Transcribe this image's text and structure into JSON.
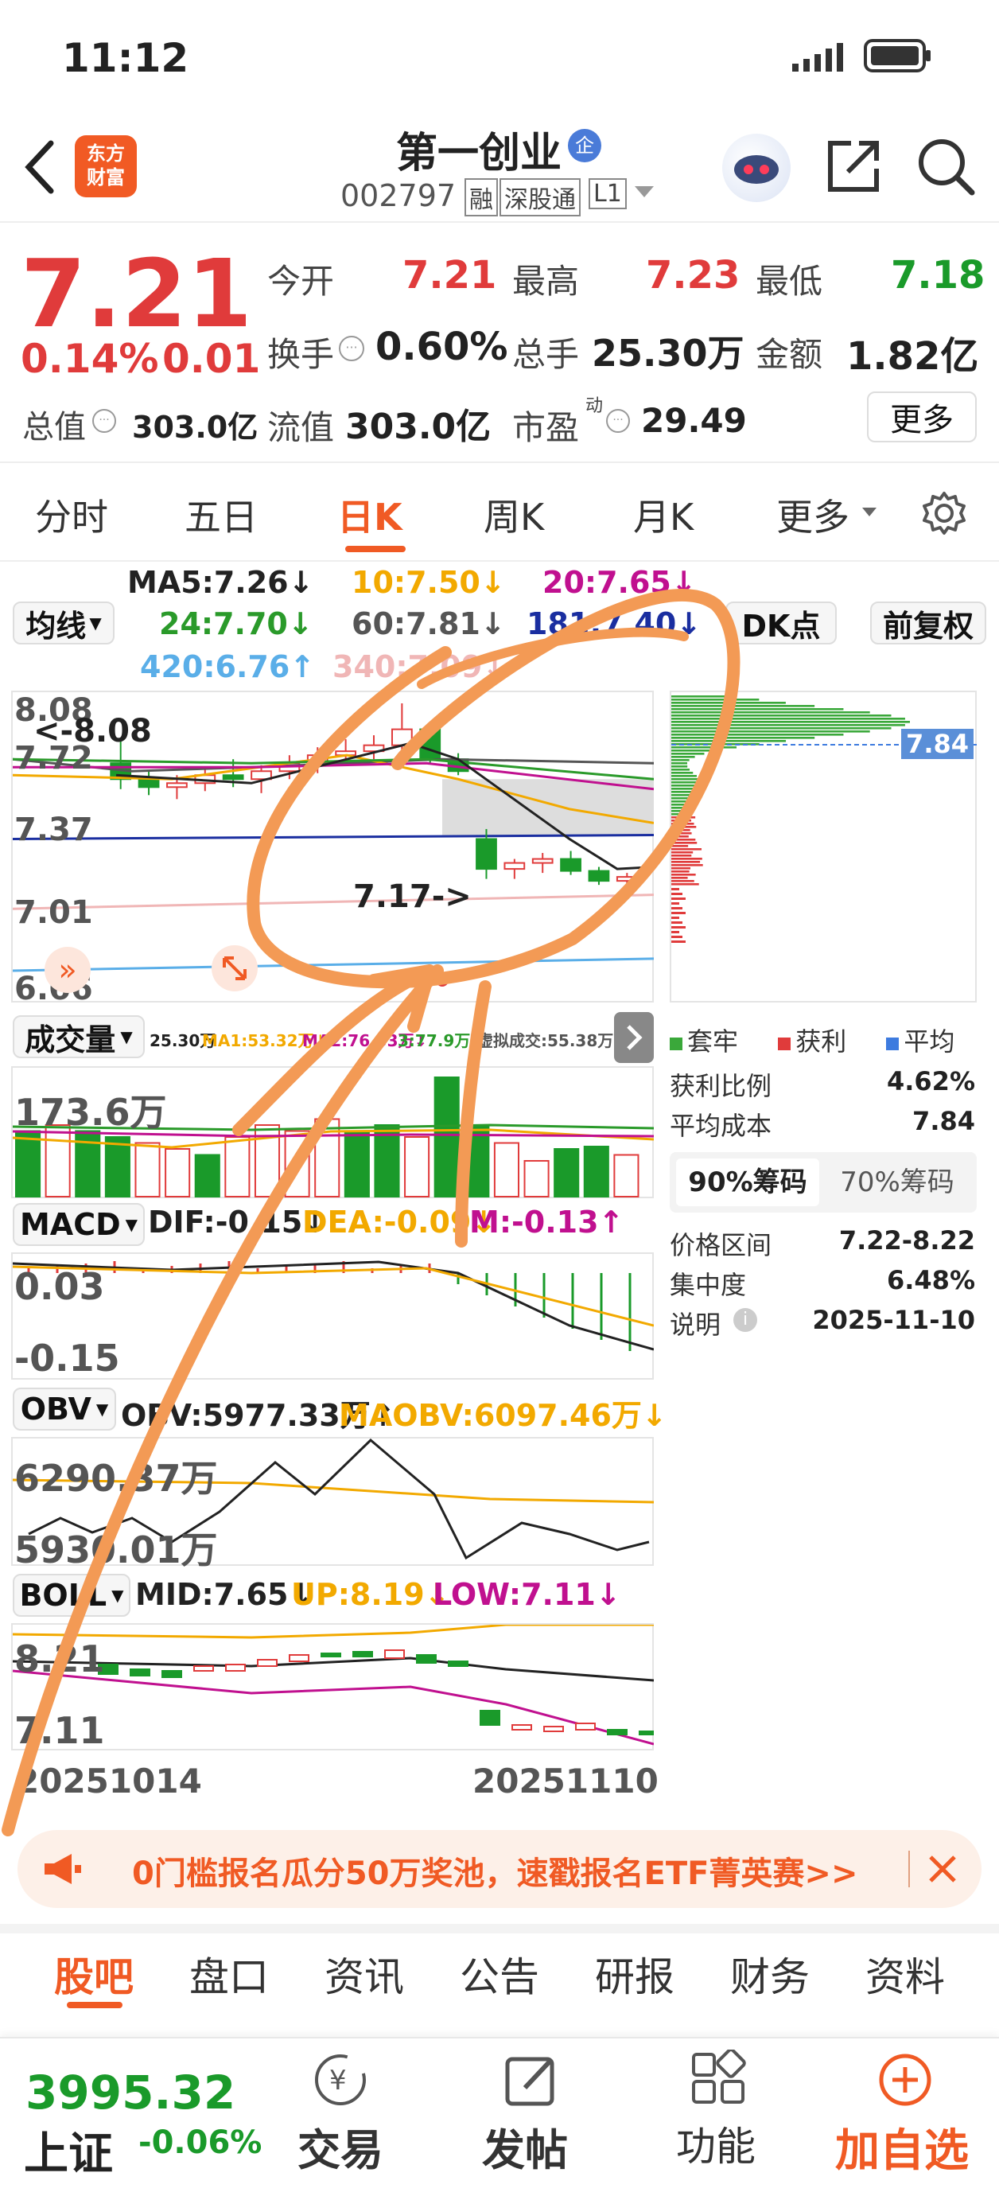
{
  "status": {
    "time": "11:12"
  },
  "header": {
    "name": "第一创业",
    "code": "002797",
    "badges": [
      "融",
      "深股通",
      "L1"
    ],
    "logo_text": "东方财富",
    "logo_line1": "东方",
    "logo_line2": "财富"
  },
  "quote": {
    "price": "7.21",
    "change_pct": "0.14%",
    "change": "0.01",
    "open_label": "今开",
    "open": "7.21",
    "high_label": "最高",
    "high": "7.23",
    "low_label": "最低",
    "low": "7.18",
    "turnover_label": "换手",
    "turnover": "0.60%",
    "vol_label": "总手",
    "vol": "25.30万",
    "amount_label": "金额",
    "amount": "1.82亿",
    "mktcap_label": "总值",
    "mktcap": "303.0亿",
    "float_label": "流值",
    "float": "303.0亿",
    "pe_label": "市盈",
    "pe_sup": "动",
    "pe": "29.49",
    "more": "更多"
  },
  "tabs": [
    "分时",
    "五日",
    "日K",
    "周K",
    "月K",
    "更多"
  ],
  "ma": {
    "btn": "均线",
    "ma5": "MA5:7.26↓",
    "ma10": "10:7.50↓",
    "ma20": "20:7.65↓",
    "ma24": "24:7.70↓",
    "ma60": "60:7.81↓",
    "ma181": "181:7.40↓",
    "ma420": "420:6.76↑",
    "ma340": "340:7.09↓",
    "dk": "DK点",
    "fq": "前复权"
  },
  "kline": {
    "yticks": [
      "8.08",
      "7.72",
      "7.37",
      "7.01",
      "6.66"
    ],
    "hi_label": "<-8.08",
    "lo_label": "7.17->",
    "cyq_price": "7.84"
  },
  "volume": {
    "btn": "成交量",
    "legend": "25.30万",
    "ma1": "MA1:53.32万↓",
    "ma2": "MA2:76.33万↓",
    "ma3": "3:77.9万↓",
    "virt": "虚拟成交:55.38万",
    "ytick": "173.6万"
  },
  "macd": {
    "btn": "MACD",
    "dif": "DIF:-0.15↓",
    "dea": "DEA:-0.09↓",
    "m": "M:-0.13↑",
    "yticks": [
      "0.03",
      "-0.15"
    ]
  },
  "obv": {
    "btn": "OBV",
    "obv": "OBV:5977.33万↑",
    "maobv": "MAOBV:6097.46万↓",
    "yticks": [
      "6290.37万",
      "5930.01万"
    ]
  },
  "boll": {
    "btn": "BOLL",
    "mid": "MID:7.65↓",
    "up": "UP:8.19↓",
    "low": "LOW:7.11↓",
    "yticks": [
      "8.21",
      "7.11"
    ]
  },
  "dates": [
    "20251014",
    "20251110"
  ],
  "cyq": {
    "legend": [
      "套牢",
      "获利",
      "平均"
    ],
    "profit_label": "获利比例",
    "profit": "4.62%",
    "avg_label": "平均成本",
    "avg": "7.84",
    "tab90": "90%筹码",
    "tab70": "70%筹码",
    "range_label": "价格区间",
    "range": "7.22-8.22",
    "conc_label": "集中度",
    "conc": "6.48%",
    "note_label": "说明",
    "note": "2025-11-10"
  },
  "banner": "0门槛报名瓜分50万奖池，速戳报名ETF菁英赛>>",
  "bottom_tabs": [
    "股吧",
    "盘口",
    "资讯",
    "公告",
    "研报",
    "财务",
    "资料"
  ],
  "nav": {
    "index_val": "3995.32",
    "index_name": "上证",
    "index_chg": "-0.06%",
    "trade": "交易",
    "post": "发帖",
    "func": "功能",
    "add": "加自选"
  },
  "chart_data": {
    "type": "candlestick",
    "title": "",
    "x": [
      "20251014",
      "20251110"
    ],
    "ylim": [
      6.66,
      8.08
    ],
    "ohlc": [
      [
        7.78,
        7.9,
        7.65,
        7.7
      ],
      [
        7.7,
        7.74,
        7.62,
        7.66
      ],
      [
        7.66,
        7.72,
        7.6,
        7.68
      ],
      [
        7.68,
        7.75,
        7.64,
        7.72
      ],
      [
        7.72,
        7.8,
        7.66,
        7.7
      ],
      [
        7.7,
        7.77,
        7.63,
        7.74
      ],
      [
        7.74,
        7.82,
        7.7,
        7.78
      ],
      [
        7.78,
        7.86,
        7.73,
        7.82
      ],
      [
        7.82,
        7.9,
        7.77,
        7.84
      ],
      [
        7.84,
        7.92,
        7.8,
        7.87
      ],
      [
        7.87,
        8.08,
        7.83,
        7.95
      ],
      [
        7.95,
        7.98,
        7.78,
        7.8
      ],
      [
        7.8,
        7.83,
        7.72,
        7.74
      ],
      [
        7.4,
        7.45,
        7.2,
        7.25
      ],
      [
        7.25,
        7.3,
        7.2,
        7.28
      ],
      [
        7.28,
        7.33,
        7.23,
        7.3
      ],
      [
        7.3,
        7.34,
        7.22,
        7.24
      ],
      [
        7.24,
        7.26,
        7.17,
        7.19
      ],
      [
        7.19,
        7.23,
        7.17,
        7.21
      ]
    ]
  }
}
